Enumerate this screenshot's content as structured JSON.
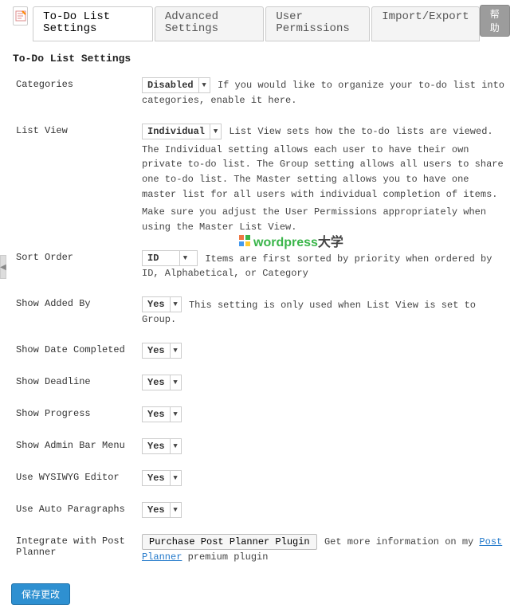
{
  "help_button": "帮助",
  "tabs": {
    "t0": "To-Do List Settings",
    "t1": "Advanced Settings",
    "t2": "User Permissions",
    "t3": "Import/Export"
  },
  "section_title": "To-Do List Settings",
  "fields": {
    "categories": {
      "label": "Categories",
      "value": "Disabled",
      "desc": "If you would like to organize your to-do list into categories, enable it here."
    },
    "list_view": {
      "label": "List View",
      "value": "Individual",
      "desc_inline": "List View sets how the to-do lists are viewed.",
      "desc_para1": "The Individual setting allows each user to have their own private to-do list. The Group setting allows all users to share one to-do list. The Master setting allows you to have one master list for all users with individual completion of items.",
      "desc_para2": "Make sure you adjust the User Permissions appropriately when using the Master List View."
    },
    "sort_order": {
      "label": "Sort Order",
      "value": "ID",
      "desc": "Items are first sorted by priority when ordered by ID, Alphabetical, or Category"
    },
    "show_added_by": {
      "label": "Show Added By",
      "value": "Yes",
      "desc": "This setting is only used when List View is set to Group."
    },
    "show_date_completed": {
      "label": "Show Date Completed",
      "value": "Yes"
    },
    "show_deadline": {
      "label": "Show Deadline",
      "value": "Yes"
    },
    "show_progress": {
      "label": "Show Progress",
      "value": "Yes"
    },
    "show_admin_bar_menu": {
      "label": "Show Admin Bar Menu",
      "value": "Yes"
    },
    "use_wysiwyg": {
      "label": "Use WYSIWYG Editor",
      "value": "Yes"
    },
    "use_auto_paragraphs": {
      "label": "Use Auto Paragraphs",
      "value": "Yes"
    },
    "integrate_post_planner": {
      "label": "Integrate with Post Planner",
      "button": "Purchase Post Planner Plugin",
      "desc_pre": "Get more information on my ",
      "link_text": "Post Planner",
      "desc_post": " premium plugin"
    }
  },
  "save_button": "保存更改",
  "watermark": {
    "text1": "wordpress",
    "text2": "大学"
  }
}
